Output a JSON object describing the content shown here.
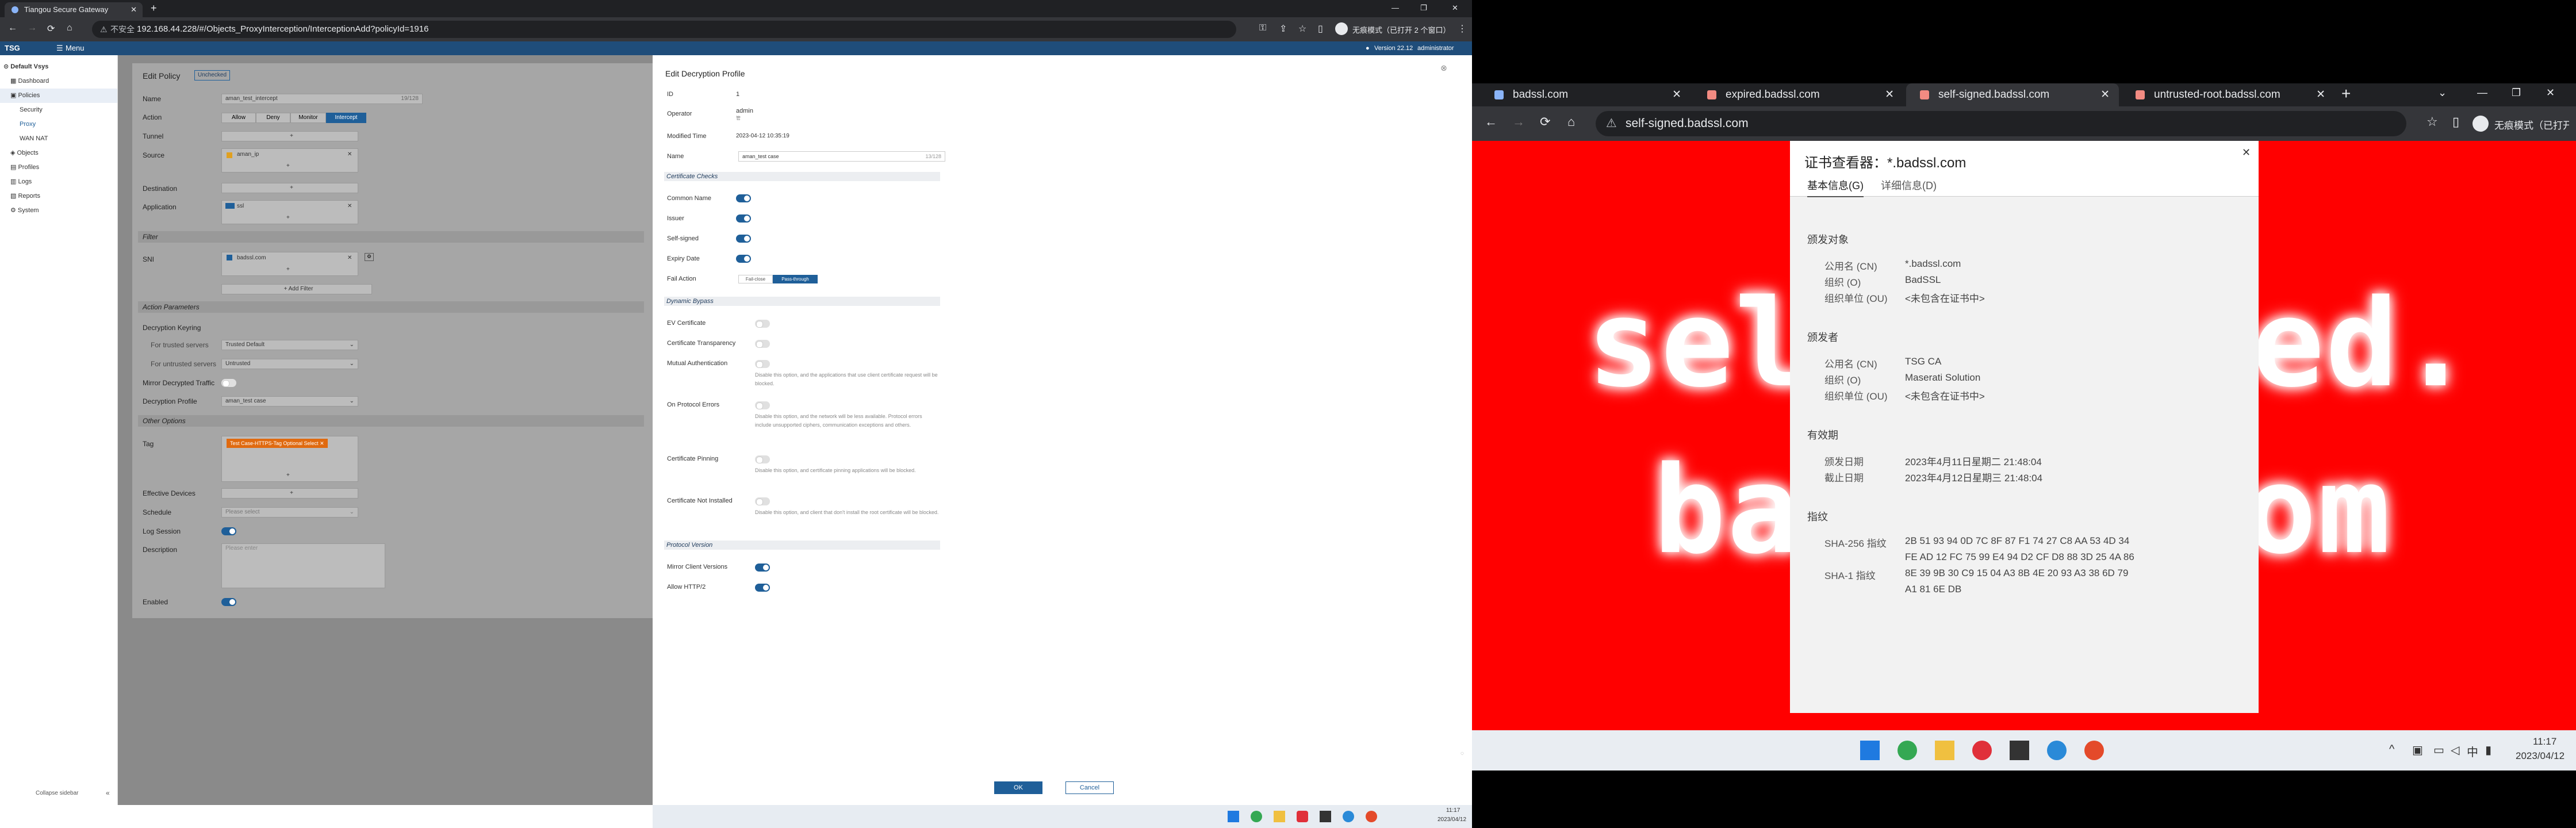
{
  "left_browser": {
    "tab_title": "Tiangou Secure Gateway",
    "address_prefix": "不安全",
    "url": "192.168.44.228/#/Objects_ProxyInterception/InterceptionAdd?policyId=1916",
    "incognito": "无痕模式（已打开 2 个窗口）"
  },
  "tsg": {
    "logo": "TSG",
    "menu": "Menu",
    "version": "Version 22.12",
    "user": "administrator"
  },
  "sidebar": {
    "items": [
      "Default Vsys",
      "Dashboard",
      "Policies",
      "Security",
      "Proxy",
      "WAN NAT",
      "Objects",
      "Profiles",
      "Logs",
      "Reports",
      "System"
    ],
    "collapse": "Collapse sidebar"
  },
  "policy": {
    "title": "Edit Policy",
    "badge": "Unchecked",
    "name_label": "Name",
    "name_value": "aman_test_intercept",
    "name_count": "19/128",
    "action_label": "Action",
    "actions": [
      "Allow",
      "Deny",
      "Monitor",
      "Intercept"
    ],
    "tunnel_label": "Tunnel",
    "source_label": "Source",
    "source_value": "aman_ip",
    "destination_label": "Destination",
    "application_label": "Application",
    "application_value": "ssl",
    "filter_section": "Filter",
    "sni_label": "SNI",
    "sni_value": "badssl.com",
    "add_filter": "+ Add Filter",
    "action_params": "Action Parameters",
    "dec_keyring": "Decryption Keyring",
    "trusted_label": "For trusted servers",
    "trusted_value": "Trusted Default",
    "untrusted_label": "For untrusted servers",
    "untrusted_value": "Untrusted",
    "mirror_label": "Mirror Decrypted Traffic",
    "dec_profile_label": "Decryption Profile",
    "dec_profile_value": "aman_test case",
    "other_options": "Other Options",
    "tag_label": "Tag",
    "tag_value": "Test Case-HTTPS-Tag Optional Select",
    "effective_devices": "Effective Devices",
    "schedule_label": "Schedule",
    "schedule_placeholder": "Please select",
    "log_session": "Log Session",
    "description_label": "Description",
    "description_placeholder": "Please enter",
    "enabled": "Enabled"
  },
  "profile": {
    "title": "Edit Decryption Profile",
    "id_label": "ID",
    "id_value": "1",
    "operator_label": "Operator",
    "operator_value": "admin",
    "operator_sub": "管",
    "modified_label": "Modified Time",
    "modified_value": "2023-04-12 10:35:19",
    "name_label": "Name",
    "name_value": "aman_test case",
    "name_count": "13/128",
    "cert_checks": "Certificate Checks",
    "common_name": "Common Name",
    "issuer": "Issuer",
    "self_signed": "Self-signed",
    "expiry": "Expiry Date",
    "fail_action": "Fail Action",
    "fail_close": "Fail-close",
    "pass_through": "Pass-through",
    "dynamic_bypass": "Dynamic Bypass",
    "ev_cert": "EV Certificate",
    "cert_transparency": "Certificate Transparency",
    "mutual_auth": "Mutual Authentication",
    "mutual_hint": "Disable this option, and the applications that use client certificate request will be blocked.",
    "on_protocol": "On Protocol Errors",
    "protocol_hint": "Disable this option, and the network will be less available. Protocol errors include unsupported ciphers, communication exceptions and others.",
    "cert_pinning": "Certificate Pinning",
    "pinning_hint": "Disable this option, and certificate pinning applications will be blocked.",
    "cert_not_installed": "Certificate Not Installed",
    "not_installed_hint": "Disable this option, and client that don't install the root certificate will be blocked.",
    "protocol_version": "Protocol Version",
    "mirror_client": "Mirror Client Versions",
    "allow_http2": "Allow HTTP/2",
    "ok": "OK",
    "cancel": "Cancel"
  },
  "left_clock": {
    "time": "11:17",
    "date": "2023/04/12"
  },
  "right_browser": {
    "tabs": [
      "badssl.com",
      "expired.badssl.com",
      "self-signed.badssl.com",
      "untrusted-root.badssl.com"
    ],
    "url": "self-signed.badssl.com",
    "incognito": "无痕模式（已打开 2 个窗口）",
    "page_line1": "self-signed.",
    "page_line2": "badssl.com"
  },
  "cert_viewer": {
    "title": "证书查看器：*.badssl.com",
    "tab_general": "基本信息(G)",
    "tab_details": "详细信息(D)",
    "issued_to": "颁发对象",
    "cn_label": "公用名 (CN)",
    "cn_value": "*.badssl.com",
    "o_label": "组织 (O)",
    "o_value": "BadSSL",
    "ou_label": "组织单位 (OU)",
    "ou_value": "<未包含在证书中>",
    "issued_by": "颁发者",
    "icn_value": "TSG CA",
    "io_value": "Maserati Solution",
    "iou_value": "<未包含在证书中>",
    "validity": "有效期",
    "issued_on_label": "颁发日期",
    "issued_on": "2023年4月11日星期二 21:48:04",
    "expires_label": "截止日期",
    "expires": "2023年4月12日星期三 21:48:04",
    "fingerprints": "指纹",
    "sha256_label": "SHA-256 指纹",
    "sha256_1": "2B 51 93 94 0D 7C 8F 87 F1 74 27 C8 AA 53 4D 34",
    "sha256_2": "FE AD 12 FC 75 99 E4 94 D2 CF D8 88 3D 25 4A 86",
    "sha1_label": "SHA-1 指纹",
    "sha1_1": "8E 39 9B 30 C9 15 04 A3 8B 4E 20 93 A3 38 6D 79",
    "sha1_2": "A1 81 6E DB"
  },
  "right_clock": {
    "time": "11:17",
    "date": "2023/04/12"
  }
}
